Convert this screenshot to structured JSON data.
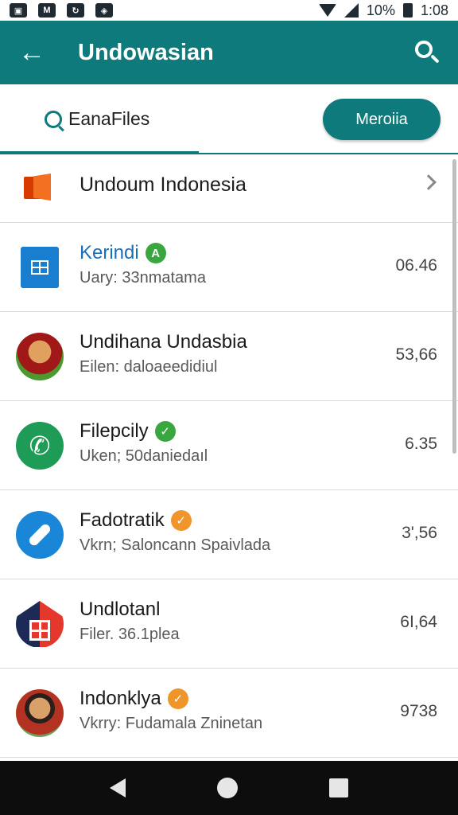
{
  "status_bar": {
    "battery": "10%",
    "time": "1:08",
    "notif_icons": [
      "image-icon",
      "mail-icon",
      "sync-icon",
      "shield-icon"
    ]
  },
  "app_bar": {
    "title": "Undowasian"
  },
  "tabs": {
    "files_label": "EanaFiles",
    "media_button": "Meroiia"
  },
  "header_row": {
    "label": "Undoum Indonesia"
  },
  "list": [
    {
      "title": "Kerindi",
      "badge": "A",
      "badge_color": "#3aa640",
      "subtitle": "Uary: 33nmatama",
      "value": "06.46",
      "icon": "sheet-icon",
      "title_color": "#1a6fb8"
    },
    {
      "title": "Undihana Undasbia",
      "badge": "",
      "badge_color": "",
      "subtitle": "Eilen: daloaeedidiul",
      "value": "53,66",
      "icon": "avatar-portrait"
    },
    {
      "title": "Filepcily",
      "badge": "✓",
      "badge_color": "#3aa640",
      "subtitle": "Uken; 50daniedaıl",
      "value": "6.35",
      "icon": "phone-icon"
    },
    {
      "title": "Fadotratik",
      "badge": "✓",
      "badge_color": "#f0952a",
      "subtitle": "Vkrn; Saloncann Spaivlada",
      "value": "3',56",
      "icon": "compass-icon"
    },
    {
      "title": "Undlotanl",
      "badge": "",
      "badge_color": "",
      "subtitle": "Filer. 36.1plea",
      "value": "6I,64",
      "icon": "house-icon"
    },
    {
      "title": "Indonklya",
      "badge": "✓",
      "badge_color": "#f0952a",
      "subtitle": "Vkrry: Fudamala Zninetan",
      "value": "9738",
      "icon": "avatar-portrait"
    }
  ],
  "colors": {
    "primary": "#0e7a7c",
    "nav_bar": "#0d0d0d"
  }
}
